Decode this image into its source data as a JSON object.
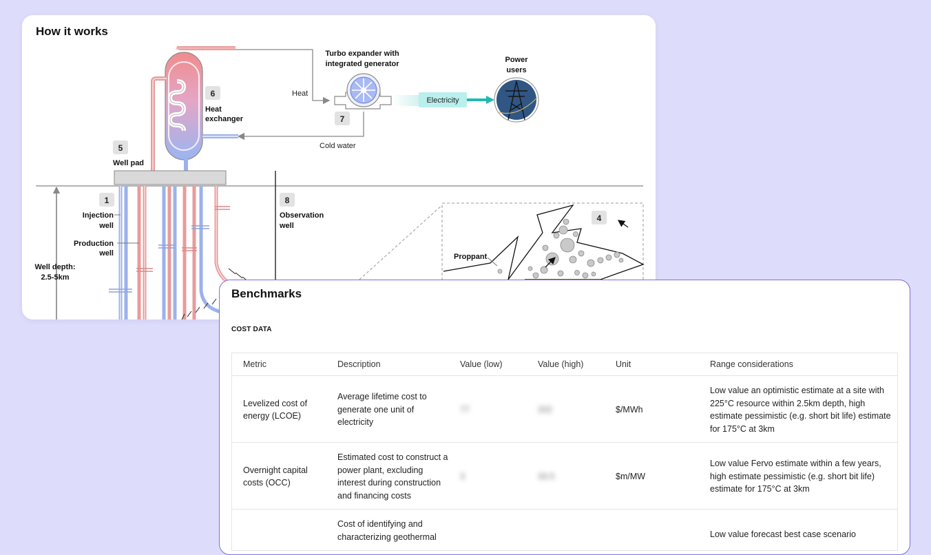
{
  "how_it_works": {
    "title": "How it works",
    "steps": [
      {
        "num": "1",
        "label_lines": [
          "Injection",
          "well"
        ]
      },
      {
        "num": "4",
        "label_lines": []
      },
      {
        "num": "5",
        "label_lines": [
          "Well pad"
        ]
      },
      {
        "num": "6",
        "label_lines": [
          "Heat",
          "exchanger"
        ]
      },
      {
        "num": "7",
        "label_lines": []
      },
      {
        "num": "8",
        "label_lines": [
          "Observation",
          "well"
        ]
      }
    ],
    "labels": {
      "production_well": [
        "Production",
        "well"
      ],
      "well_depth": [
        "Well depth:",
        "2.5-5km"
      ],
      "turbo": [
        "Turbo expander with",
        "integrated generator"
      ],
      "power_users": [
        "Power",
        "users"
      ],
      "heat": "Heat",
      "cold_water": "Cold water",
      "electricity": "Electricity",
      "proppant": "Proppant"
    },
    "colors": {
      "hot": "#e89b9b",
      "cold": "#9db2ea",
      "accent": "#20b9b2"
    }
  },
  "benchmarks": {
    "title": "Benchmarks",
    "section_label": "COST DATA",
    "columns": [
      "Metric",
      "Description",
      "Value (low)",
      "Value (high)",
      "Unit",
      "Range considerations"
    ],
    "rows": [
      {
        "metric": "Levelized cost of energy (LCOE)",
        "description": "Average lifetime cost to generate one unit of electricity",
        "value_low": "77",
        "value_high": "202",
        "unit": "$/MWh",
        "range": "Low value an optimistic estimate at a site with 225°C resource within 2.5km depth, high estimate pessimistic (e.g. short bit life) estimate for 175°C at 3km"
      },
      {
        "metric": "Overnight capital costs (OCC)",
        "description": "Estimated cost to construct a power plant, excluding interest during construction and financing costs",
        "value_low": "3",
        "value_high": "33.5",
        "unit": "$m/MW",
        "range": "Low value Fervo estimate within a few years, high estimate pessimistic (e.g. short bit life) estimate for 175°C at 3km"
      },
      {
        "metric": "",
        "description": "Cost of identifying and characterizing geothermal",
        "value_low": "",
        "value_high": "",
        "unit": "",
        "range": "Low value forecast best case scenario"
      }
    ]
  }
}
